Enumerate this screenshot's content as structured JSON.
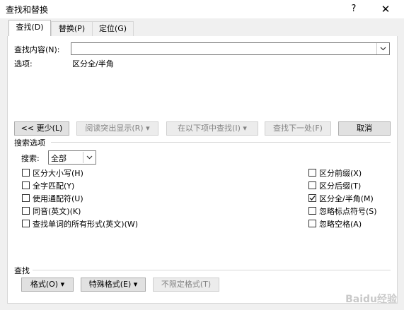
{
  "window": {
    "title": "查找和替换",
    "help_glyph": "?",
    "close_glyph": "✕"
  },
  "tabs": [
    {
      "label": "查找(D)",
      "active": true
    },
    {
      "label": "替换(P)",
      "active": false
    },
    {
      "label": "定位(G)",
      "active": false
    }
  ],
  "find": {
    "label": "查找内容(N):",
    "value": "",
    "options_label": "选项:",
    "options_value": "区分全/半角"
  },
  "buttons": {
    "less": "<< 更少(L)",
    "reading_highlight": "阅读突出显示(R)",
    "find_in": "在以下项中查找(I)",
    "find_next": "查找下一处(F)",
    "cancel": "取消"
  },
  "search_options": {
    "section_title": "搜索选项",
    "search_label": "搜索:",
    "search_value": "全部",
    "left": [
      {
        "label": "区分大小写(H)",
        "checked": false
      },
      {
        "label": "全字匹配(Y)",
        "checked": false
      },
      {
        "label": "使用通配符(U)",
        "checked": false
      },
      {
        "label": "同音(英文)(K)",
        "checked": false
      },
      {
        "label": "查找单词的所有形式(英文)(W)",
        "checked": false
      }
    ],
    "right": [
      {
        "label": "区分前缀(X)",
        "checked": false
      },
      {
        "label": "区分后缀(T)",
        "checked": false
      },
      {
        "label": "区分全/半角(M)",
        "checked": true
      },
      {
        "label": "忽略标点符号(S)",
        "checked": false
      },
      {
        "label": "忽略空格(A)",
        "checked": false
      }
    ]
  },
  "bottom": {
    "section_title": "查找",
    "format": "格式(O)",
    "special": "特殊格式(E)",
    "no_format": "不限定格式(T)"
  },
  "watermark": "Baidu经验",
  "icons": {
    "dropdown": "chevron-down-icon",
    "check": "checkmark-icon"
  }
}
